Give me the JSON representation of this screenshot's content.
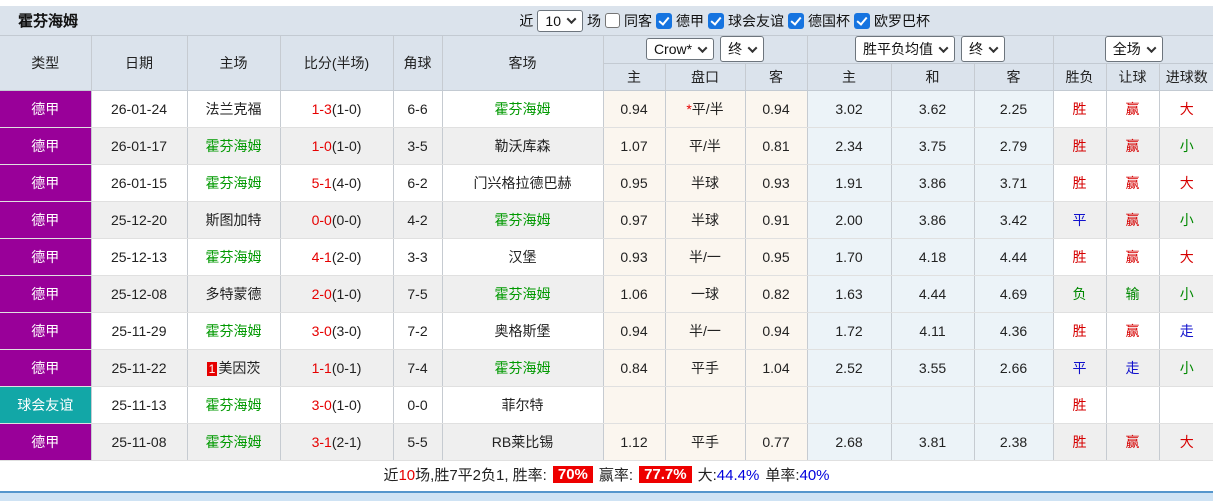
{
  "title": "霍芬海姆",
  "filters": {
    "recent_label": "近",
    "recent_value": "10",
    "matches_label": "场",
    "same_venue": {
      "label": "同客",
      "checked": false
    },
    "leagues": [
      {
        "label": "德甲",
        "checked": true
      },
      {
        "label": "球会友谊",
        "checked": true
      },
      {
        "label": "德国杯",
        "checked": true
      },
      {
        "label": "欧罗巴杯",
        "checked": true
      }
    ]
  },
  "header": {
    "left_columns": [
      "类型",
      "日期",
      "主场",
      "比分(半场)",
      "角球",
      "客场"
    ],
    "odds_group": {
      "select_company": "Crow*",
      "select_stage": "终",
      "columns": [
        "主",
        "盘口",
        "客"
      ]
    },
    "avg_group": {
      "select_type": "胜平负均值",
      "select_stage": "终",
      "columns": [
        "主",
        "和",
        "客"
      ]
    },
    "result_group": {
      "select_scope": "全场",
      "columns": [
        "胜负",
        "让球",
        "进球数"
      ]
    }
  },
  "rows": [
    {
      "league": "德甲",
      "league_type": "league",
      "date": "26-01-24",
      "home": {
        "name": "法兰克福",
        "self": false,
        "badge": ""
      },
      "score": {
        "main": "1-3",
        "half": "(1-0)"
      },
      "corners": "6-6",
      "away": {
        "name": "霍芬海姆",
        "self": true
      },
      "odds": {
        "home": "0.94",
        "handicap": "平/半",
        "star": true,
        "away": "0.94"
      },
      "avg": {
        "home": "3.02",
        "draw": "3.62",
        "away": "2.25"
      },
      "results": {
        "outcome": {
          "text": "胜",
          "color": "red"
        },
        "handicap": {
          "text": "赢",
          "color": "red"
        },
        "goals": {
          "text": "大",
          "color": "red"
        }
      }
    },
    {
      "league": "德甲",
      "league_type": "league",
      "date": "26-01-17",
      "home": {
        "name": "霍芬海姆",
        "self": true,
        "badge": ""
      },
      "score": {
        "main": "1-0",
        "half": "(1-0)"
      },
      "corners": "3-5",
      "away": {
        "name": "勒沃库森",
        "self": false
      },
      "odds": {
        "home": "1.07",
        "handicap": "平/半",
        "star": false,
        "away": "0.81"
      },
      "avg": {
        "home": "2.34",
        "draw": "3.75",
        "away": "2.79"
      },
      "results": {
        "outcome": {
          "text": "胜",
          "color": "red"
        },
        "handicap": {
          "text": "赢",
          "color": "red"
        },
        "goals": {
          "text": "小",
          "color": "green"
        }
      }
    },
    {
      "league": "德甲",
      "league_type": "league",
      "date": "26-01-15",
      "home": {
        "name": "霍芬海姆",
        "self": true,
        "badge": ""
      },
      "score": {
        "main": "5-1",
        "half": "(4-0)"
      },
      "corners": "6-2",
      "away": {
        "name": "门兴格拉德巴赫",
        "self": false
      },
      "odds": {
        "home": "0.95",
        "handicap": "半球",
        "star": false,
        "away": "0.93"
      },
      "avg": {
        "home": "1.91",
        "draw": "3.86",
        "away": "3.71"
      },
      "results": {
        "outcome": {
          "text": "胜",
          "color": "red"
        },
        "handicap": {
          "text": "赢",
          "color": "red"
        },
        "goals": {
          "text": "大",
          "color": "red"
        }
      }
    },
    {
      "league": "德甲",
      "league_type": "league",
      "date": "25-12-20",
      "home": {
        "name": "斯图加特",
        "self": false,
        "badge": ""
      },
      "score": {
        "main": "0-0",
        "half": "(0-0)"
      },
      "corners": "4-2",
      "away": {
        "name": "霍芬海姆",
        "self": true
      },
      "odds": {
        "home": "0.97",
        "handicap": "半球",
        "star": false,
        "away": "0.91"
      },
      "avg": {
        "home": "2.00",
        "draw": "3.86",
        "away": "3.42"
      },
      "results": {
        "outcome": {
          "text": "平",
          "color": "blue"
        },
        "handicap": {
          "text": "赢",
          "color": "red"
        },
        "goals": {
          "text": "小",
          "color": "green"
        }
      }
    },
    {
      "league": "德甲",
      "league_type": "league",
      "date": "25-12-13",
      "home": {
        "name": "霍芬海姆",
        "self": true,
        "badge": ""
      },
      "score": {
        "main": "4-1",
        "half": "(2-0)"
      },
      "corners": "3-3",
      "away": {
        "name": "汉堡",
        "self": false
      },
      "odds": {
        "home": "0.93",
        "handicap": "半/一",
        "star": false,
        "away": "0.95"
      },
      "avg": {
        "home": "1.70",
        "draw": "4.18",
        "away": "4.44"
      },
      "results": {
        "outcome": {
          "text": "胜",
          "color": "red"
        },
        "handicap": {
          "text": "赢",
          "color": "red"
        },
        "goals": {
          "text": "大",
          "color": "red"
        }
      }
    },
    {
      "league": "德甲",
      "league_type": "league",
      "date": "25-12-08",
      "home": {
        "name": "多特蒙德",
        "self": false,
        "badge": ""
      },
      "score": {
        "main": "2-0",
        "half": "(1-0)"
      },
      "corners": "7-5",
      "away": {
        "name": "霍芬海姆",
        "self": true
      },
      "odds": {
        "home": "1.06",
        "handicap": "一球",
        "star": false,
        "away": "0.82"
      },
      "avg": {
        "home": "1.63",
        "draw": "4.44",
        "away": "4.69"
      },
      "results": {
        "outcome": {
          "text": "负",
          "color": "green"
        },
        "handicap": {
          "text": "输",
          "color": "green"
        },
        "goals": {
          "text": "小",
          "color": "green"
        }
      }
    },
    {
      "league": "德甲",
      "league_type": "league",
      "date": "25-11-29",
      "home": {
        "name": "霍芬海姆",
        "self": true,
        "badge": ""
      },
      "score": {
        "main": "3-0",
        "half": "(3-0)"
      },
      "corners": "7-2",
      "away": {
        "name": "奥格斯堡",
        "self": false
      },
      "odds": {
        "home": "0.94",
        "handicap": "半/一",
        "star": false,
        "away": "0.94"
      },
      "avg": {
        "home": "1.72",
        "draw": "4.11",
        "away": "4.36"
      },
      "results": {
        "outcome": {
          "text": "胜",
          "color": "red"
        },
        "handicap": {
          "text": "赢",
          "color": "red"
        },
        "goals": {
          "text": "走",
          "color": "blue"
        }
      }
    },
    {
      "league": "德甲",
      "league_type": "league",
      "date": "25-11-22",
      "home": {
        "name": "美因茨",
        "self": false,
        "badge": "1"
      },
      "score": {
        "main": "1-1",
        "half": "(0-1)"
      },
      "corners": "7-4",
      "away": {
        "name": "霍芬海姆",
        "self": true
      },
      "odds": {
        "home": "0.84",
        "handicap": "平手",
        "star": false,
        "away": "1.04"
      },
      "avg": {
        "home": "2.52",
        "draw": "3.55",
        "away": "2.66"
      },
      "results": {
        "outcome": {
          "text": "平",
          "color": "blue"
        },
        "handicap": {
          "text": "走",
          "color": "blue"
        },
        "goals": {
          "text": "小",
          "color": "green"
        }
      }
    },
    {
      "league": "球会友谊",
      "league_type": "friendly",
      "date": "25-11-13",
      "home": {
        "name": "霍芬海姆",
        "self": true,
        "badge": ""
      },
      "score": {
        "main": "3-0",
        "half": "(1-0)"
      },
      "corners": "0-0",
      "away": {
        "name": "菲尔特",
        "self": false
      },
      "odds": {
        "home": "",
        "handicap": "",
        "star": false,
        "away": ""
      },
      "avg": {
        "home": "",
        "draw": "",
        "away": ""
      },
      "results": {
        "outcome": {
          "text": "胜",
          "color": "red"
        },
        "handicap": {
          "text": "",
          "color": "red"
        },
        "goals": {
          "text": "",
          "color": "red"
        }
      }
    },
    {
      "league": "德甲",
      "league_type": "league",
      "date": "25-11-08",
      "home": {
        "name": "霍芬海姆",
        "self": true,
        "badge": ""
      },
      "score": {
        "main": "3-1",
        "half": "(2-1)"
      },
      "corners": "5-5",
      "away": {
        "name": "RB莱比锡",
        "self": false
      },
      "odds": {
        "home": "1.12",
        "handicap": "平手",
        "star": false,
        "away": "0.77"
      },
      "avg": {
        "home": "2.68",
        "draw": "3.81",
        "away": "2.38"
      },
      "results": {
        "outcome": {
          "text": "胜",
          "color": "red"
        },
        "handicap": {
          "text": "赢",
          "color": "red"
        },
        "goals": {
          "text": "大",
          "color": "red"
        }
      }
    }
  ],
  "footer": {
    "recent_label": "近",
    "recent_num": "10",
    "summary": "场,胜7平2负1, 胜率:",
    "win_rate": "70%",
    "handicap_label": "赢率:",
    "handicap_rate": "77.7%",
    "over_label": "大:",
    "over_rate": "44.4%",
    "odd_label": "单率:",
    "odd_rate": "40%"
  },
  "colors": {
    "header_bg": "#dbe3ec",
    "league_bg": "#990099",
    "friendly_bg": "#12a7a7",
    "self_green": "#009900",
    "score_red": "#e60000",
    "win_red": "#d60000",
    "draw_blue": "#1111cc",
    "lose_green": "#008800",
    "odds_bg": "#fbf6ef",
    "avg_bg": "#ecf3f8",
    "check_blue": "#1674e0",
    "badge_bg": "#e60000",
    "pct_bg": "#ee0000",
    "footer_value_blue": "#0000dd",
    "bottom_bar_bg": "#cfe3f4"
  }
}
